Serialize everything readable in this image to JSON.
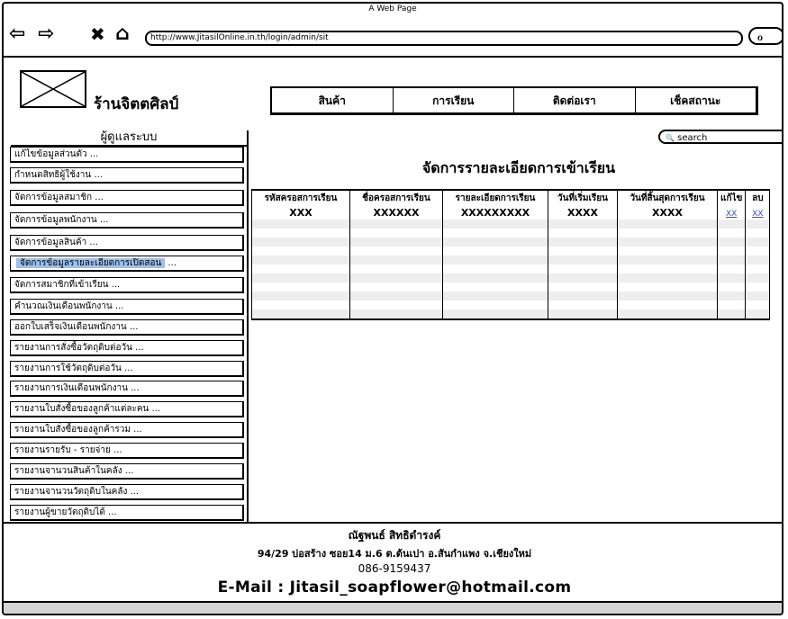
{
  "window": {
    "title": "A Web Page"
  },
  "browser": {
    "url": "http://www.JitasilOnline.in.th/login/admin/sit",
    "back_glyph": "⇦",
    "forward_glyph": "⇨",
    "stop_glyph": "✖",
    "home_glyph": "⌂",
    "refresh_glyph": "ℴ"
  },
  "header": {
    "site_title": "ร้านจิตตศิลป์",
    "nav": [
      "สินค้า",
      "การเรียน",
      "ติดต่อเรา",
      "เช็คสถานะ"
    ]
  },
  "sidebar": {
    "title": "ผู้ดูแลระบบ",
    "items": [
      {
        "label": "แก้ไขข้อมูลส่วนตัว   ..."
      },
      {
        "label": "กำหนดสิทธิผู้ใช้งาน   ..."
      },
      {
        "label": "จัดการข้อมูลสมาชิก   ..."
      },
      {
        "label": "จัดการข้อมูลพนักงาน   ..."
      },
      {
        "label": "จัดการข้อมูลสินค้า   ..."
      },
      {
        "label": "จัดการข้อมูลรายละเอียดการเปิดสอน",
        "suffix": " ...",
        "selected": true
      },
      {
        "label": "จัดการสมาชิกที่เข้าเรียน   ..."
      },
      {
        "label": "คำนวณเงินเดือนพนักงาน   ..."
      },
      {
        "label": "ออกใบเสร็จเงินเดือนพนักงาน   ..."
      },
      {
        "label": "รายงานการสั่งซื้อวัตถุดิบต่อวัน   ..."
      },
      {
        "label": "รายงานการใช้วัตถุดิบต่อวัน   ..."
      },
      {
        "label": "รายงานการเงินเดือนพนักงาน   ..."
      },
      {
        "label": "รายงานใบสั่งซื้อของลูกค้าแต่ละคน   ..."
      },
      {
        "label": "รายงานใบสั่งซื้อของลูกค้ารวม   ..."
      },
      {
        "label": "รายงานรายรับ - รายจ่าย   ..."
      },
      {
        "label": "รายงานจานวนสินค้าในคลัง   ..."
      },
      {
        "label": "รายงานจานวนวัตถุดิบในคลัง   ..."
      },
      {
        "label": "รายงานผู้ขายวัตถุดิบได้   ..."
      }
    ]
  },
  "main": {
    "search_placeholder": "search",
    "search_icon_glyph": "🔍",
    "title": "จัดการรายละเอียดการเข้าเรียน",
    "table": {
      "headers": [
        "รหัสครอสการเรียน",
        "ชื่อครอสการเรียน",
        "รายละเอียดการเรียน",
        "วันที่เริ่มเรียน",
        "วันที่สิ้นสุดการเรียน",
        "แก้ไข",
        "ลบ"
      ],
      "row": [
        "XXX",
        "XXXXXX",
        "XXXXXXXXX",
        "XXXX",
        "XXXX",
        "XX",
        "XX"
      ]
    }
  },
  "footer": {
    "name": "ณัฐพนธ์ สิทธิดำรงค์",
    "address": "94/29 บ่อสร้าง ซอย14 ม.6 ต.ต้นเปา อ.สันกำแพง จ.เชียงใหม่",
    "phone": "086-9159437",
    "email": "E-Mail : Jitasil_soapflower@hotmail.com"
  }
}
